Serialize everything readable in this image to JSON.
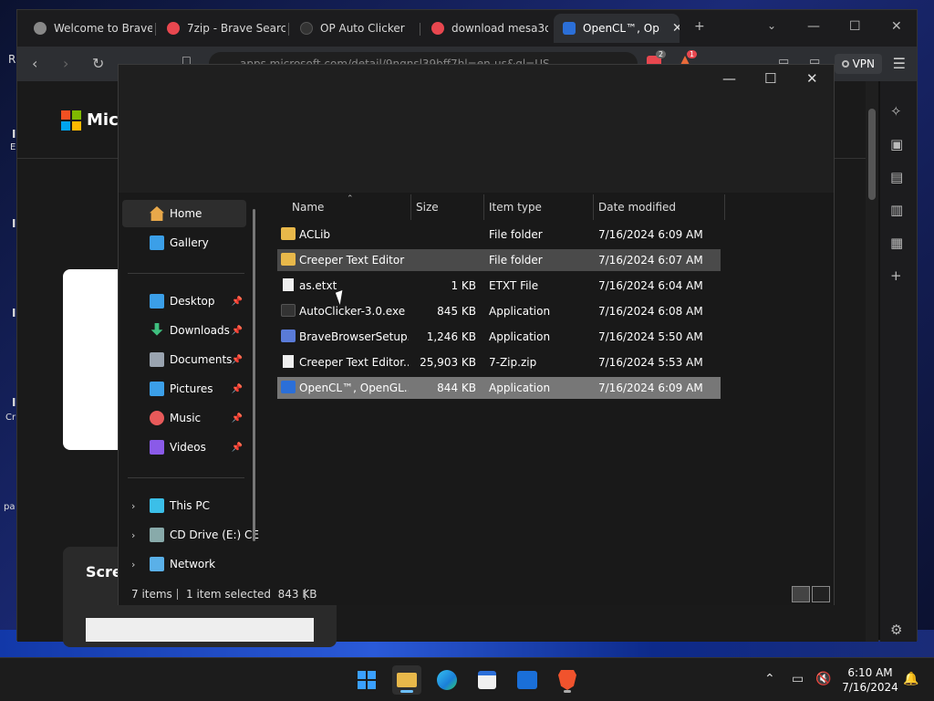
{
  "browser": {
    "tabs": [
      {
        "label": "Welcome to Brave",
        "active": false
      },
      {
        "label": "7zip - Brave Search",
        "active": false
      },
      {
        "label": "OP Auto Clicker",
        "active": false
      },
      {
        "label": "download mesa3d",
        "active": false
      },
      {
        "label": "OpenCL™, Op",
        "active": true
      }
    ],
    "url": "apps.microsoft.com/detail/9nqnsl39bff7hl=en-us&gl=US",
    "vpn_label": "VPN",
    "shield_count": "2",
    "rewards_count": "1",
    "page": {
      "brand": "Micr",
      "screenshots_heading": "Scre"
    },
    "edge_letters": [
      "R",
      "I",
      "E",
      "I",
      "I",
      "I",
      "Cr",
      "pa"
    ]
  },
  "explorer": {
    "nav": {
      "home": "Home",
      "gallery": "Gallery",
      "pinned": [
        {
          "label": "Desktop",
          "icon": "desktop-icon",
          "color": "#3b9fe8"
        },
        {
          "label": "Downloads",
          "icon": "downloads-icon",
          "color": "#3fbf7f"
        },
        {
          "label": "Documents",
          "icon": "documents-icon",
          "color": "#9aa4b0"
        },
        {
          "label": "Pictures",
          "icon": "pictures-icon",
          "color": "#3b9fe8"
        },
        {
          "label": "Music",
          "icon": "music-icon",
          "color": "#e85a5a"
        },
        {
          "label": "Videos",
          "icon": "videos-icon",
          "color": "#8a5ae8"
        }
      ],
      "drives": [
        {
          "label": "This PC",
          "icon": "this-pc-icon"
        },
        {
          "label": "CD Drive (E:) CE",
          "icon": "cd-drive-icon"
        },
        {
          "label": "Network",
          "icon": "network-icon"
        }
      ]
    },
    "columns": [
      "Name",
      "Size",
      "Item type",
      "Date modified"
    ],
    "files": [
      {
        "name": "ACLib",
        "size": "",
        "type": "File folder",
        "date": "7/16/2024 6:09 AM",
        "icon": "folder"
      },
      {
        "name": "Creeper Text Editor",
        "size": "",
        "type": "File folder",
        "date": "7/16/2024 6:07 AM",
        "icon": "folder"
      },
      {
        "name": "as.etxt",
        "size": "1 KB",
        "type": "ETXT File",
        "date": "7/16/2024 6:04 AM",
        "icon": "doc"
      },
      {
        "name": "AutoClicker-3.0.exe",
        "size": "845 KB",
        "type": "Application",
        "date": "7/16/2024 6:08 AM",
        "icon": "app"
      },
      {
        "name": "BraveBrowserSetup...",
        "size": "1,246 KB",
        "type": "Application",
        "date": "7/16/2024 5:50 AM",
        "icon": "setup"
      },
      {
        "name": "Creeper Text Editor....",
        "size": "25,903 KB",
        "type": "7-Zip.zip",
        "date": "7/16/2024 5:53 AM",
        "icon": "doc"
      },
      {
        "name": "OpenCL™, OpenGL...",
        "size": "844 KB",
        "type": "Application",
        "date": "7/16/2024 6:09 AM",
        "icon": "dl"
      }
    ],
    "status": {
      "count": "7 items",
      "selection": "1 item selected  843 KB"
    }
  },
  "taskbar": {
    "time": "6:10 AM",
    "date": "7/16/2024"
  }
}
